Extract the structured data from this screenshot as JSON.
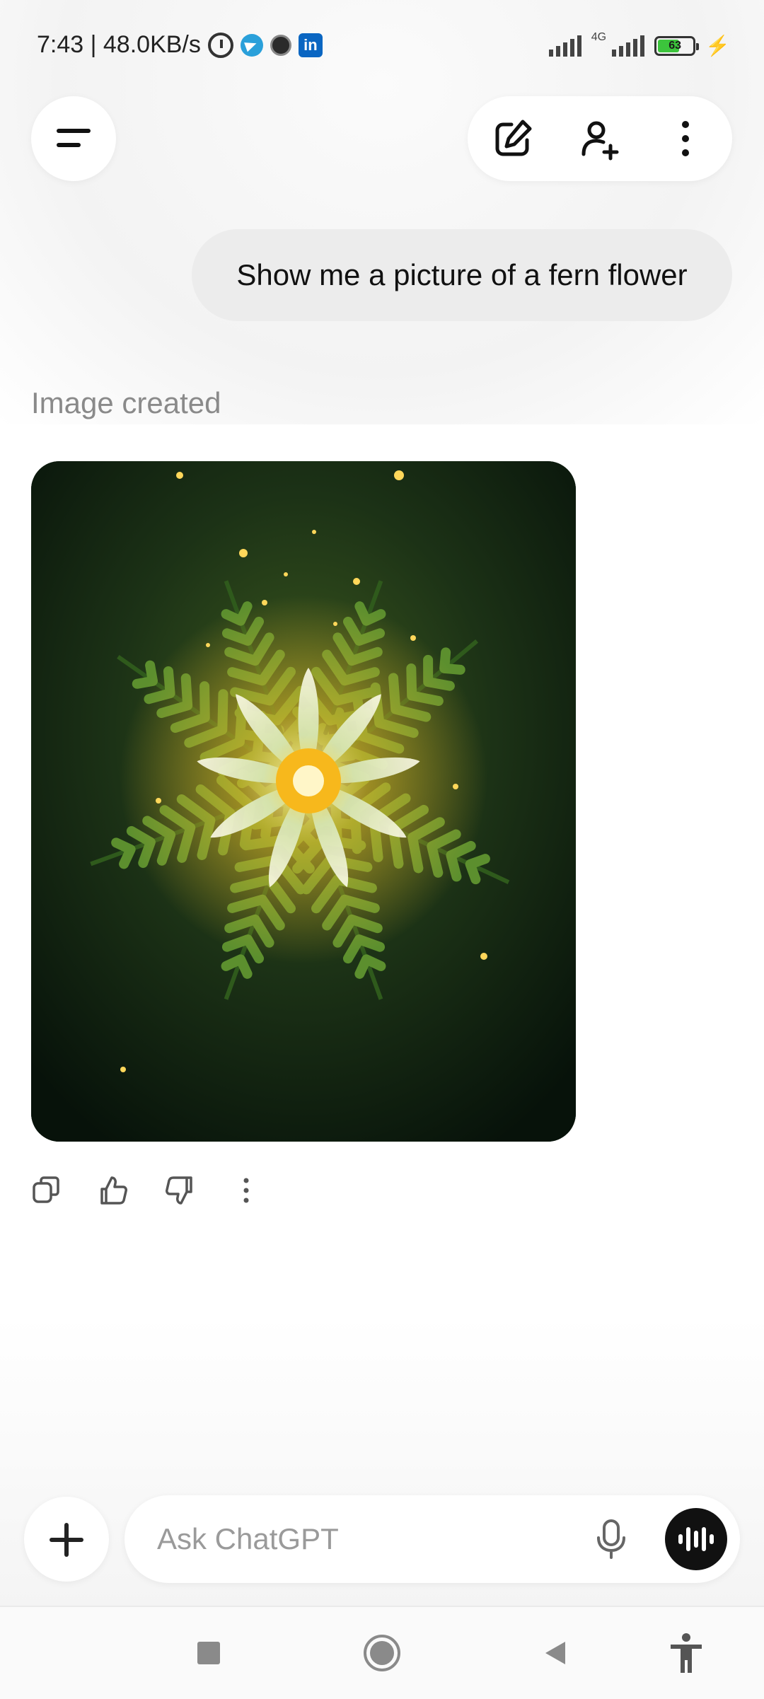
{
  "status_bar": {
    "time_speed": "7:43 | 48.0KB/s",
    "network": "4G",
    "battery": "63",
    "battery_level": 0.63,
    "icons": [
      "alarm-icon",
      "telegram-icon",
      "app-icon",
      "linkedin-icon"
    ],
    "linkedin_glyph": "in"
  },
  "top_bar": {
    "menu_icon": "menu-icon",
    "actions": [
      "new-chat-icon",
      "add-user-icon",
      "more-icon"
    ]
  },
  "conversation": {
    "user_message": "Show me a picture of a fern flower",
    "assistant_status": "Image created",
    "image_subject": "glowing-fern-flower-image",
    "message_actions": [
      "copy-icon",
      "thumbs-up-icon",
      "thumbs-down-icon",
      "more-vertical-icon"
    ]
  },
  "composer": {
    "placeholder": "Ask ChatGPT",
    "value": "",
    "icons": [
      "plus-icon",
      "microphone-icon",
      "voice-mode-icon"
    ]
  },
  "nav_bar": {
    "icons": [
      "recents-icon",
      "home-icon",
      "back-icon",
      "accessibility-icon"
    ]
  },
  "colors": {
    "user_bubble": "#ececec",
    "muted_text": "#8a8a8a",
    "voice_button": "#111111",
    "battery_fill": "#3cc43c"
  }
}
